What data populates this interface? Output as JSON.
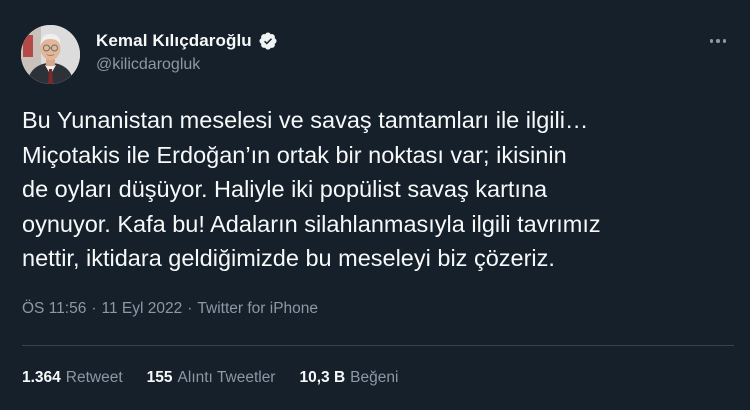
{
  "author": {
    "display_name": "Kemal Kılıçdaroğlu",
    "handle": "@kilicdarogluk",
    "avatar_icon": "portrait-avatar",
    "verified_icon": "verified-badge-icon"
  },
  "tweet": {
    "text_lines": [
      "Bu Yunanistan meselesi ve savaş tamtamları ile ilgili…",
      "Miçotakis ile Erdoğan’ın ortak bir noktası var; ikisinin",
      "de oyları düşüyor. Haliyle iki popülist savaş kartına",
      "oynuyor. Kafa bu! Adaların silahlanmasıyla ilgili tavrımız",
      "nettir, iktidara geldiğimizde bu meseleyi biz çözeriz."
    ],
    "time": "ÖS 11:56",
    "date": "11 Eyl 2022",
    "separator": "·",
    "source": "Twitter for iPhone"
  },
  "stats": {
    "retweets_count": "1.364",
    "retweets_label": "Retweet",
    "quotes_count": "155",
    "quotes_label": "Alıntı Tweetler",
    "likes_count": "10,3 B",
    "likes_label": "Beğeni"
  },
  "colors": {
    "background": "#15202b",
    "text_primary": "#f7f9f9",
    "text_secondary": "#8b98a5",
    "divider": "#38444d"
  }
}
